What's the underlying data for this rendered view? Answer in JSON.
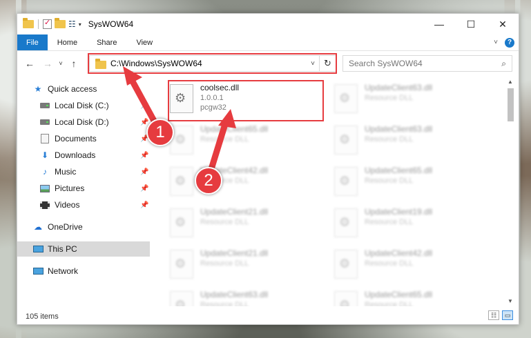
{
  "window": {
    "title": "SysWOW64",
    "controls": {
      "minimize": "—",
      "maximize": "☐",
      "close": "✕"
    }
  },
  "ribbon": {
    "tabs": [
      {
        "label": "File",
        "active": true
      },
      {
        "label": "Home"
      },
      {
        "label": "Share"
      },
      {
        "label": "View"
      }
    ],
    "collapse_glyph": "˅",
    "help_glyph": "?"
  },
  "navigation": {
    "back": "←",
    "forward": "→",
    "recent": "˅",
    "up": "↑",
    "address": "C:\\Windows\\SysWOW64",
    "address_dropdown": "˅",
    "refresh": "↻",
    "search_placeholder": "Search SysWOW64",
    "search_glyph": "⌕"
  },
  "sidebar": {
    "items": [
      {
        "label": "Quick access",
        "icon": "star-icon"
      },
      {
        "label": "Local Disk (C:)",
        "icon": "drive-icon",
        "pinned": true
      },
      {
        "label": "Local Disk (D:)",
        "icon": "drive-icon",
        "pinned": true
      },
      {
        "label": "Documents",
        "icon": "documents-icon",
        "pinned": true
      },
      {
        "label": "Downloads",
        "icon": "download-icon",
        "pinned": true
      },
      {
        "label": "Music",
        "icon": "music-icon",
        "pinned": true
      },
      {
        "label": "Pictures",
        "icon": "pictures-icon",
        "pinned": true
      },
      {
        "label": "Videos",
        "icon": "videos-icon",
        "pinned": true
      },
      {
        "label": "OneDrive",
        "icon": "onedrive-icon"
      },
      {
        "label": "This PC",
        "icon": "this-pc-icon",
        "selected": true
      },
      {
        "label": "Network",
        "icon": "network-icon"
      }
    ],
    "pin_glyph": "📌"
  },
  "files": {
    "highlighted": {
      "name": "coolsec.dll",
      "version": "1.0.0.1",
      "company": "pcgw32"
    },
    "blurred": [
      {
        "name": "UpdateClient63.dll",
        "type": "Resource DLL"
      },
      {
        "name": "UpdateClient65.dll",
        "type": "Resource DLL"
      },
      {
        "name": "UpdateClient63.dll",
        "type": "Resource DLL"
      },
      {
        "name": "UpdateClient42.dll",
        "type": "Resource DLL"
      },
      {
        "name": "UpdateClient65.dll",
        "type": "Resource DLL"
      },
      {
        "name": "UpdateClient21.dll",
        "type": "Resource DLL"
      },
      {
        "name": "UpdateClient19.dll",
        "type": "Resource DLL"
      },
      {
        "name": "UpdateClient21.dll",
        "type": "Resource DLL"
      },
      {
        "name": "UpdateClient42.dll",
        "type": "Resource DLL"
      },
      {
        "name": "UpdateClient63.dll",
        "type": "Resource DLL"
      },
      {
        "name": "UpdateClient65.dll",
        "type": "Resource DLL"
      }
    ]
  },
  "status": {
    "item_count": "105 items"
  },
  "annotations": {
    "step1": "1",
    "step2": "2",
    "color": "#e63b3f"
  },
  "accent_color": "#1979ca"
}
